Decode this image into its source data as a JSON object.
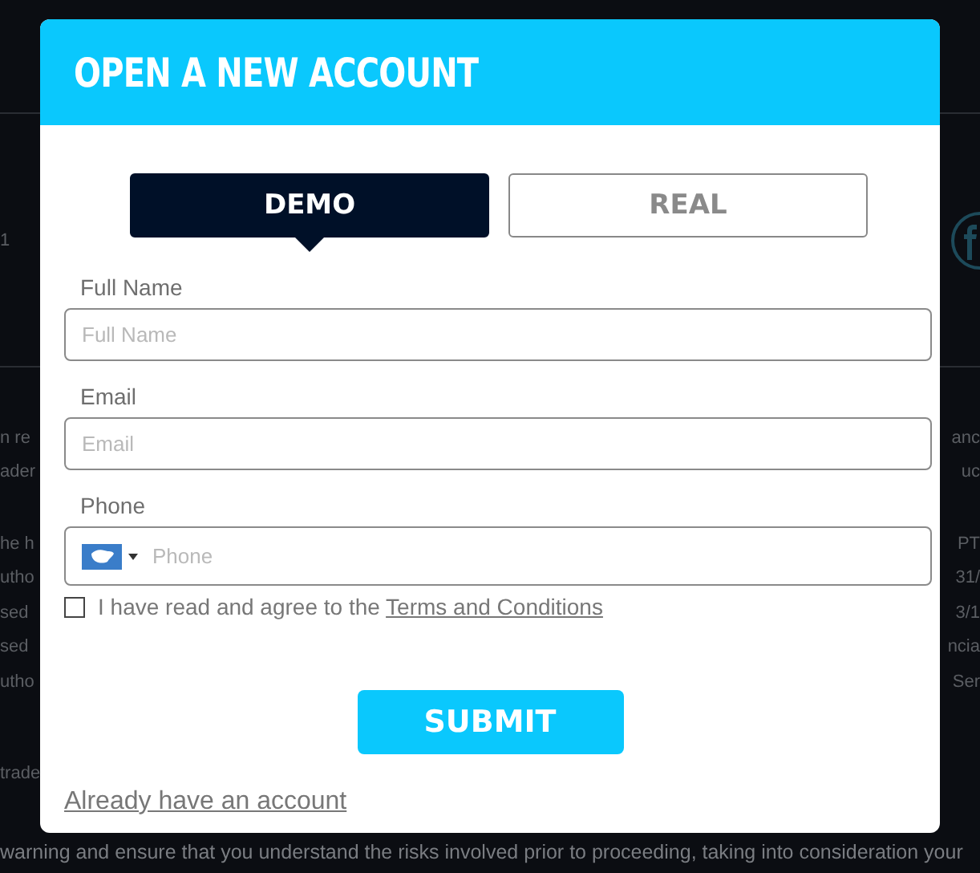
{
  "background": {
    "corner_text": "1",
    "left_fragments": [
      "n re",
      "ader",
      "he h",
      "utho",
      "sed",
      "sed",
      "utho"
    ],
    "right_fragments": [
      "anc",
      "uc",
      "PT",
      "31/",
      "3/1",
      "ncia",
      "Ser"
    ],
    "bottom_fragment": "trade",
    "bottom_line": "warning and ensure that you understand the risks involved prior to proceeding, taking into consideration your"
  },
  "modal": {
    "title": "OPEN A NEW ACCOUNT",
    "tabs": [
      {
        "label": "DEMO",
        "selected": true
      },
      {
        "label": "REAL",
        "selected": false
      }
    ],
    "fields": [
      {
        "kind": "text",
        "label": "Full Name",
        "placeholder": "Full Name"
      },
      {
        "kind": "text",
        "label": "Email",
        "placeholder": "Email"
      },
      {
        "kind": "phone",
        "label": "Phone",
        "placeholder": "Phone"
      }
    ],
    "agreement": {
      "checked": false,
      "text": "I have read and agree to the",
      "link": "Terms and Conditions"
    },
    "submit": "SUBMIT",
    "login_link": "Already have an account"
  }
}
